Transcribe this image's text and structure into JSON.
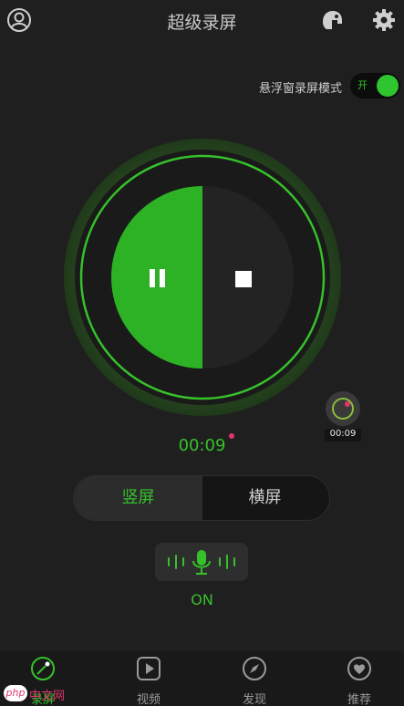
{
  "header": {
    "title": "超级录屏",
    "profile_icon": "user-circle-icon",
    "skin_icon": "helmet-icon",
    "settings_icon": "gear-icon"
  },
  "floating_mode": {
    "label": "悬浮窗录屏模式",
    "toggle_text": "开",
    "enabled": true
  },
  "recorder": {
    "pause_icon": "pause-icon",
    "stop_icon": "stop-icon",
    "elapsed": "00:09",
    "recording": true
  },
  "mini_widget": {
    "time": "00:09"
  },
  "orientation": {
    "options": [
      "竖屏",
      "横屏"
    ],
    "selected": "竖屏"
  },
  "mic": {
    "status": "ON",
    "icon": "microphone-icon"
  },
  "bottom_nav": {
    "items": [
      {
        "label": "录屏",
        "icon": "record-dial-icon",
        "active": true
      },
      {
        "label": "视频",
        "icon": "play-square-icon",
        "active": false
      },
      {
        "label": "发现",
        "icon": "compass-icon",
        "active": false
      },
      {
        "label": "推荐",
        "icon": "heart-circle-icon",
        "active": false
      }
    ]
  },
  "watermark": {
    "badge": "php",
    "text": "中文网"
  },
  "colors": {
    "accent": "#36c12a",
    "background": "#1f1f1f",
    "record_dot": "#e0356e"
  }
}
